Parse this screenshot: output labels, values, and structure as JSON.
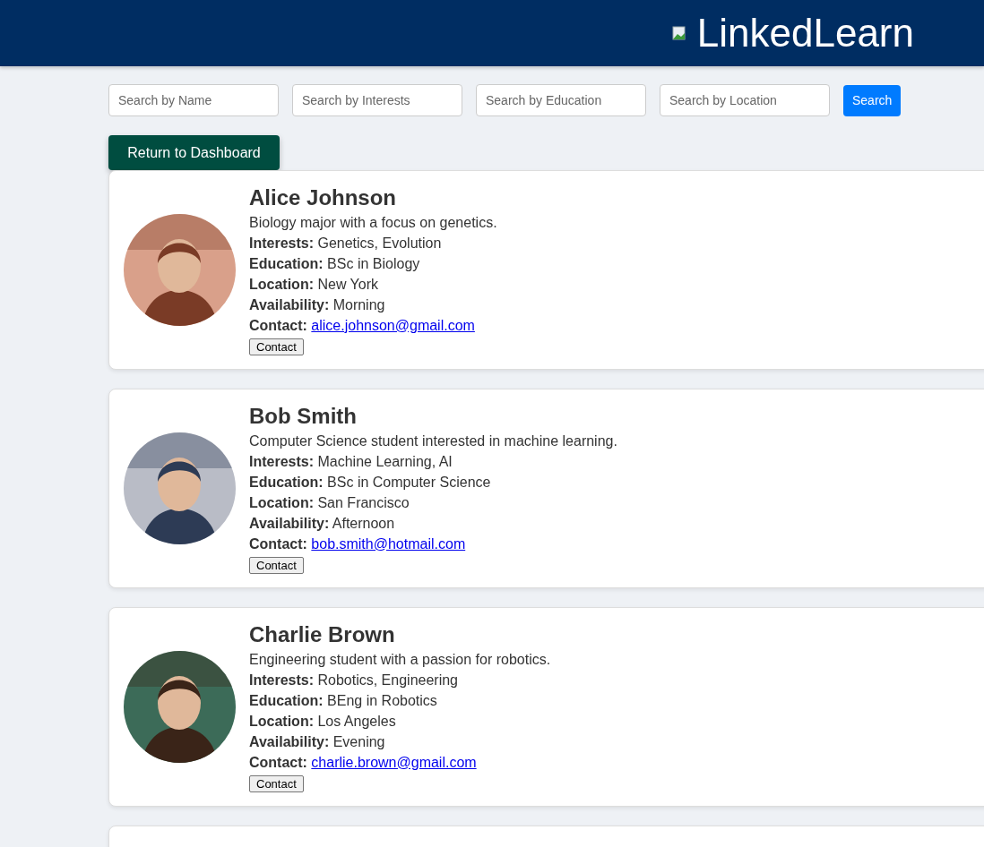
{
  "header": {
    "logo_text": "LinkedLearn"
  },
  "search": {
    "fields": [
      {
        "placeholder": "Search by Name"
      },
      {
        "placeholder": "Search by Interests"
      },
      {
        "placeholder": "Search by Education"
      },
      {
        "placeholder": "Search by Location"
      }
    ],
    "button": "Search"
  },
  "return_button": "Return to Dashboard",
  "profiles": [
    {
      "kind": "profile",
      "name": "Alice Johnson",
      "bio": "Biology major with a focus on genetics.",
      "details": [
        "**Interests:** Genetics, Evolution",
        "**Education:** BSc in Biology",
        "**Location:** New York",
        "**Availability:** Morning"
      ],
      "contact_label": "Contact:",
      "email": "alice.johnson@gmail.com",
      "contact_button": "Contact"
    },
    {
      "kind": "profile",
      "name": "Bob Smith",
      "bio": "Computer Science student interested in machine learning.",
      "details": [
        "**Interests:** Machine Learning, AI",
        "**Education:** BSc in Computer Science",
        "**Location:** San Francisco",
        "**Availability:** Afternoon"
      ],
      "contact_label": "Contact:",
      "email": "bob.smith@hotmail.com",
      "contact_button": "Contact"
    },
    {
      "kind": "profile",
      "name": "Charlie Brown",
      "bio": "Engineering student with a passion for robotics.",
      "details": [
        "**Interests:** Robotics, Engineering",
        "**Education:** BEng in Robotics",
        "**Location:** Los Angeles",
        "**Availability:** Evening"
      ],
      "contact_label": "Contact:",
      "email": "charlie.brown@gmail.com",
      "contact_button": "Contact"
    },
    {
      "kind": "cut"
    }
  ]
}
